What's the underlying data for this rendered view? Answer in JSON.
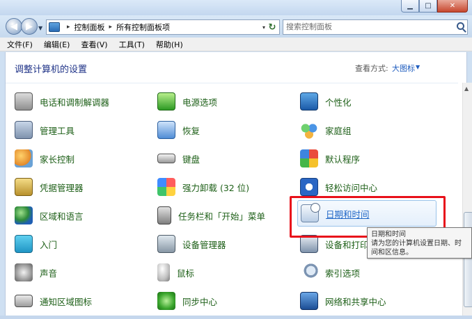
{
  "window": {
    "minimize_glyph": "▁",
    "maximize_glyph": "□",
    "close_glyph": "✕"
  },
  "nav": {
    "back_glyph": "◀",
    "forward_glyph": "▶",
    "history_glyph": "▼",
    "breadcrumb": [
      "控制面板",
      "所有控制面板项"
    ],
    "breadcrumb_sep": "▸",
    "address_dropdown_glyph": "▾",
    "refresh_glyph": "↻",
    "search_placeholder": "搜索控制面板"
  },
  "menu": [
    "文件(F)",
    "编辑(E)",
    "查看(V)",
    "工具(T)",
    "帮助(H)"
  ],
  "header": {
    "title": "调整计算机的设置",
    "viewby_label": "查看方式:",
    "viewby_value": "大图标",
    "viewby_arrow": "▼"
  },
  "items": [
    {
      "label": "电话和调制解调器",
      "icon": "phone-modem-icon"
    },
    {
      "label": "管理工具",
      "icon": "admin-tools-icon"
    },
    {
      "label": "家长控制",
      "icon": "parental-controls-icon"
    },
    {
      "label": "凭据管理器",
      "icon": "credential-manager-icon"
    },
    {
      "label": "区域和语言",
      "icon": "region-language-icon"
    },
    {
      "label": "入门",
      "icon": "getting-started-icon"
    },
    {
      "label": "声音",
      "icon": "sound-icon"
    },
    {
      "label": "通知区域图标",
      "icon": "notification-area-icon"
    },
    {
      "label": "电源选项",
      "icon": "power-options-icon"
    },
    {
      "label": "恢复",
      "icon": "recovery-icon"
    },
    {
      "label": "键盘",
      "icon": "keyboard-icon"
    },
    {
      "label": "强力卸载 (32 位)",
      "icon": "uninstaller-icon"
    },
    {
      "label": "任务栏和「开始」菜单",
      "icon": "taskbar-start-menu-icon"
    },
    {
      "label": "设备管理器",
      "icon": "device-manager-icon"
    },
    {
      "label": "鼠标",
      "icon": "mouse-icon"
    },
    {
      "label": "同步中心",
      "icon": "sync-center-icon"
    },
    {
      "label": "个性化",
      "icon": "personalization-icon"
    },
    {
      "label": "家庭组",
      "icon": "homegroup-icon"
    },
    {
      "label": "默认程序",
      "icon": "default-programs-icon"
    },
    {
      "label": "轻松访问中心",
      "icon": "ease-of-access-icon"
    },
    {
      "label": "日期和时间",
      "icon": "date-time-icon"
    },
    {
      "label": "设备和打印",
      "icon": "devices-printers-icon"
    },
    {
      "label": "索引选项",
      "icon": "indexing-options-icon"
    },
    {
      "label": "网络和共享中心",
      "icon": "network-sharing-icon"
    }
  ],
  "tooltip": {
    "title": "日期和时间",
    "body": "请为您的计算机设置日期、时间和区信息。"
  },
  "scrollbar": {
    "up_glyph": "▲",
    "grip_glyph": "≡"
  },
  "colors": {
    "item_link": "#1d5f17",
    "highlight_link": "#2268c7",
    "annotation_box": "#e8101a",
    "title": "#1e3287"
  }
}
